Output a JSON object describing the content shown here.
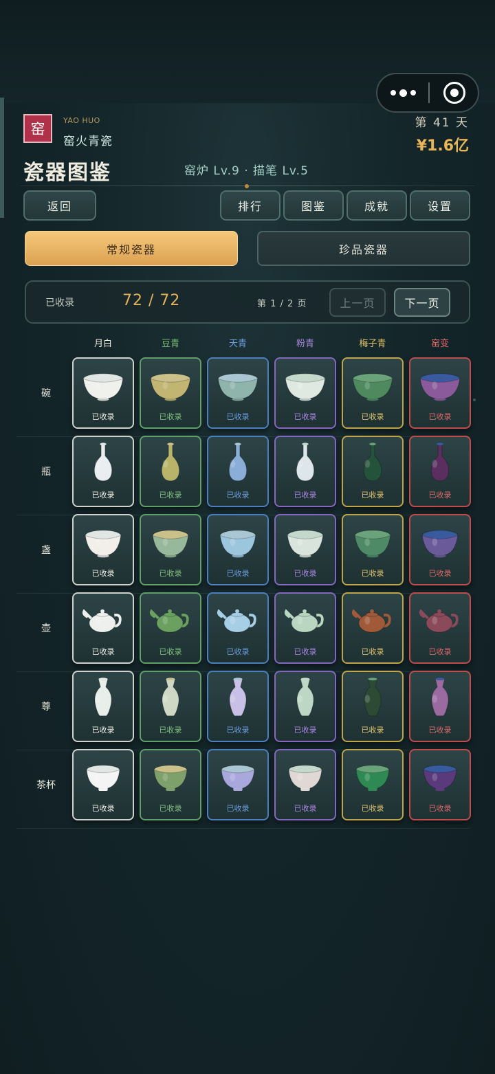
{
  "header": {
    "seal_char": "窑",
    "brand_en": "YAO HUO",
    "brand_cn": "窑火青瓷",
    "day": "第 41 天",
    "money": "¥1.6亿",
    "title": "瓷器图鉴",
    "levels": "窑炉 Lv.9 · 描笔 Lv.5"
  },
  "nav": {
    "back": "返回",
    "rank": "排行",
    "catalog": "图鉴",
    "achievement": "成就",
    "settings": "设置"
  },
  "tabs": {
    "regular": "常规瓷器",
    "rare": "珍品瓷器"
  },
  "stats": {
    "collected_label": "已收录",
    "collected_count": "72 / 72",
    "page_info": "第 1 / 2 页",
    "prev": "上一页",
    "next": "下一页"
  },
  "columns": [
    {
      "name": "月白",
      "color": "#f2efe6",
      "border": "#cfd2cc",
      "glaze": "#eeeeea",
      "inner": "#dfe6e4"
    },
    {
      "name": "豆青",
      "color": "#7fbf7a",
      "border": "#5f9f68",
      "glaze": "#b9ad72",
      "inner": "#c9c08a"
    },
    {
      "name": "天青",
      "color": "#6f9fe0",
      "border": "#4c7fc0",
      "glaze": "#8fb4c6",
      "inner": "#a9c6d2"
    },
    {
      "name": "粉青",
      "color": "#a884e0",
      "border": "#8566c0",
      "glaze": "#d4dfd8",
      "inner": "#c4d8cc"
    },
    {
      "name": "梅子青",
      "color": "#e0c26a",
      "border": "#bfa548",
      "glaze": "#4a8a62",
      "inner": "#6aa27a"
    },
    {
      "name": "窑变",
      "color": "#e06a6a",
      "border": "#c04c4c",
      "glaze": "#7a4a8a",
      "inner": "#3a5aa0"
    }
  ],
  "rows": [
    {
      "name": "碗",
      "shape": "bowl",
      "glazes": [
        "#f0f0ec",
        "#c2b471",
        "#8fb4ac",
        "#dfe9e2",
        "#4f8a5e",
        "#8a5a9a"
      ]
    },
    {
      "name": "瓶",
      "shape": "vase",
      "glazes": [
        "#eaeef0",
        "#b8b46a",
        "#8aaed8",
        "#dde6ea",
        "#24523a",
        "#5a2e5e"
      ]
    },
    {
      "name": "盏",
      "shape": "cup",
      "glazes": [
        "#f2eeea",
        "#97b89a",
        "#9cc6de",
        "#d9e5dc",
        "#4e8a66",
        "#6a5a9a"
      ]
    },
    {
      "name": "壶",
      "shape": "teapot",
      "glazes": [
        "#eef0ee",
        "#6aa060",
        "#a6cfe6",
        "#b9d6c0",
        "#a05a3a",
        "#8a4a5a"
      ]
    },
    {
      "name": "尊",
      "shape": "zun",
      "glazes": [
        "#e8eeea",
        "#cfd8c4",
        "#c8c0e6",
        "#bcd8c4",
        "#2c4a34",
        "#9a6aa0"
      ]
    },
    {
      "name": "茶杯",
      "shape": "teacup",
      "glazes": [
        "#f4f4f4",
        "#7ea06a",
        "#a8a8dc",
        "#e0d8d4",
        "#2e8a52",
        "#5a3a7a"
      ]
    }
  ],
  "card_label": "已收录"
}
